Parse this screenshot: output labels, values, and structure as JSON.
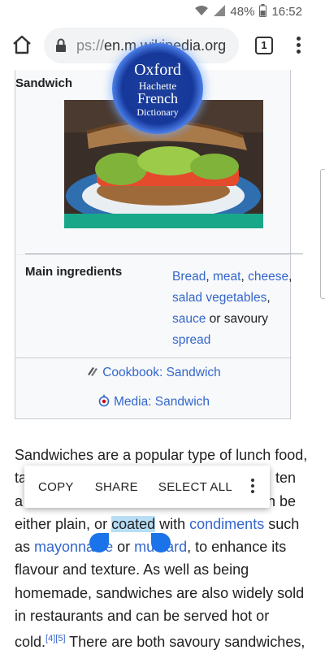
{
  "status": {
    "battery": "48%",
    "time": "16:52"
  },
  "browser": {
    "url_scheme": "ps://",
    "url_host": "en.m.wikipedia.org",
    "tab_count": "1"
  },
  "overlay": {
    "line1": "Oxford",
    "line2": "Hachette",
    "line3": "French",
    "line4": "Dictionary"
  },
  "infobox": {
    "title": "Sandwich",
    "ingredients_label": "Main ingredients",
    "ingredients": {
      "bread": "Bread",
      "meat": "meat",
      "cheese": "cheese",
      "salad": "salad vegetables",
      "sauce": "sauce",
      "or_savoury": " or savoury",
      "spread": "spread"
    },
    "cookbook": "Cookbook: Sandwich",
    "media": "Media: Sandwich"
  },
  "article": {
    "l1": "Sandwiches are a popular type of lunch food,",
    "l2a": "ta",
    "l2b": "ten",
    "l3a": "a",
    "l3b": "n be",
    "l4a": "either plain, or ",
    "l4_selected": "coated",
    "l4b": " with ",
    "l4_link": "condiments",
    "l4c": " such",
    "l5a": "as ",
    "l5_link1": "mayonnaise",
    "l5b": " or ",
    "l5_link2": "mustard",
    "l5c": ", to enhance its",
    "l6": "flavour and texture. As well as being",
    "l7": "homemade, sandwiches are also widely sold",
    "l8": "in restaurants and can be served hot or",
    "l9a": "cold.",
    "ref1": "[4]",
    "ref2": "[5]",
    "l9b": " There are both savoury sandwiches,"
  },
  "context_menu": {
    "copy": "COPY",
    "share": "SHARE",
    "select_all": "SELECT ALL"
  }
}
